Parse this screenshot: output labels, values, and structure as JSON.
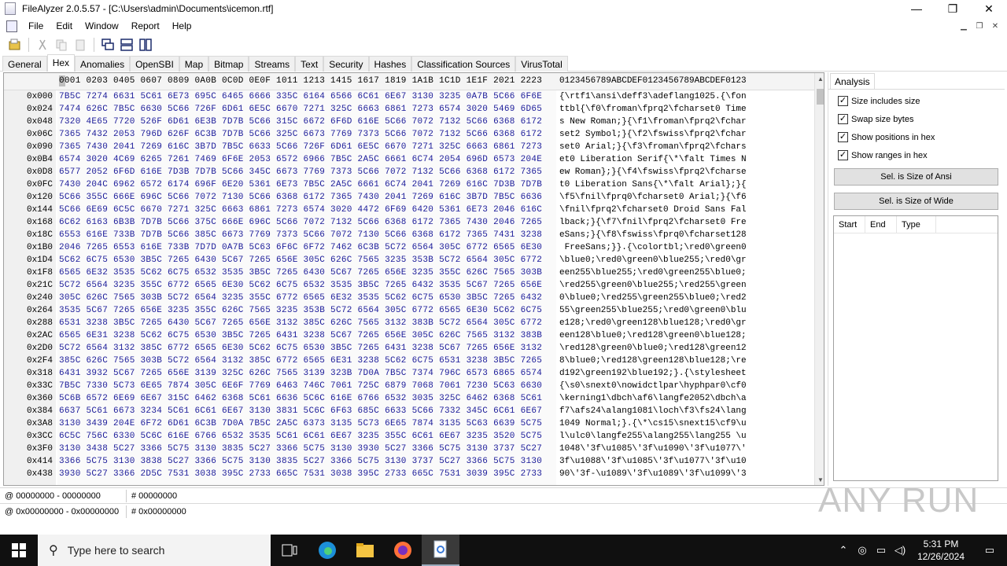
{
  "window": {
    "title": "FileAlyzer 2.0.5.57 - [C:\\Users\\admin\\Documents\\icemon.rtf]",
    "minimize": "—",
    "maximize": "❐",
    "close": "✕"
  },
  "menu": [
    "File",
    "Edit",
    "Window",
    "Report",
    "Help"
  ],
  "tabs": [
    "General",
    "Hex",
    "Anomalies",
    "OpenSBI",
    "Map",
    "Bitmap",
    "Streams",
    "Text",
    "Security",
    "Hashes",
    "Classification Sources",
    "VirusTotal"
  ],
  "active_tab": "Hex",
  "hex": {
    "column_header": "0001 0203 0405 0607 0809 0A0B 0C0D 0E0F 1011 1213 1415 1617 1819 1A1B 1C1D 1E1F 2021 2223",
    "ascii_header": "0123456789ABCDEF0123456789ABCDEF0123",
    "rows": [
      {
        "off": "0x000",
        "hex": "7B5C 7274 6631 5C61 6E73 695C 6465 6666 335C 6164 6566 6C61 6E67 3130 3235 0A7B 5C66 6F6E",
        "asc": "{\\rtf1\\ansi\\deff3\\adeflang1025.{\\fon"
      },
      {
        "off": "0x024",
        "hex": "7474 626C 7B5C 6630 5C66 726F 6D61 6E5C 6670 7271 325C 6663 6861 7273 6574 3020 5469 6D65",
        "asc": "ttbl{\\f0\\froman\\fprq2\\fcharset0 Time"
      },
      {
        "off": "0x048",
        "hex": "7320 4E65 7720 526F 6D61 6E3B 7D7B 5C66 315C 6672 6F6D 616E 5C66 7072 7132 5C66 6368 6172",
        "asc": "s New Roman;}{\\f1\\froman\\fprq2\\fchar"
      },
      {
        "off": "0x06C",
        "hex": "7365 7432 2053 796D 626F 6C3B 7D7B 5C66 325C 6673 7769 7373 5C66 7072 7132 5C66 6368 6172",
        "asc": "set2 Symbol;}{\\f2\\fswiss\\fprq2\\fchar"
      },
      {
        "off": "0x090",
        "hex": "7365 7430 2041 7269 616C 3B7D 7B5C 6633 5C66 726F 6D61 6E5C 6670 7271 325C 6663 6861 7273",
        "asc": "set0 Arial;}{\\f3\\froman\\fprq2\\fchars"
      },
      {
        "off": "0x0B4",
        "hex": "6574 3020 4C69 6265 7261 7469 6F6E 2053 6572 6966 7B5C 2A5C 6661 6C74 2054 696D 6573 204E",
        "asc": "et0 Liberation Serif{\\*\\falt Times N"
      },
      {
        "off": "0x0D8",
        "hex": "6577 2052 6F6D 616E 7D3B 7D7B 5C66 345C 6673 7769 7373 5C66 7072 7132 5C66 6368 6172 7365",
        "asc": "ew Roman};}{\\f4\\fswiss\\fprq2\\fcharse"
      },
      {
        "off": "0x0FC",
        "hex": "7430 204C 6962 6572 6174 696F 6E20 5361 6E73 7B5C 2A5C 6661 6C74 2041 7269 616C 7D3B 7D7B",
        "asc": "t0 Liberation Sans{\\*\\falt Arial};}{"
      },
      {
        "off": "0x120",
        "hex": "5C66 355C 666E 696C 5C66 7072 7130 5C66 6368 6172 7365 7430 2041 7269 616C 3B7D 7B5C 6636",
        "asc": "\\f5\\fnil\\fprq0\\fcharset0 Arial;}{\\f6"
      },
      {
        "off": "0x144",
        "hex": "5C66 6E69 6C5C 6670 7271 325C 6663 6861 7273 6574 3020 4472 6F69 6420 5361 6E73 2046 616C",
        "asc": "\\fnil\\fprq2\\fcharset0 Droid Sans Fal"
      },
      {
        "off": "0x168",
        "hex": "6C62 6163 6B3B 7D7B 5C66 375C 666E 696C 5C66 7072 7132 5C66 6368 6172 7365 7430 2046 7265",
        "asc": "lback;}{\\f7\\fnil\\fprq2\\fcharset0 Fre"
      },
      {
        "off": "0x18C",
        "hex": "6553 616E 733B 7D7B 5C66 385C 6673 7769 7373 5C66 7072 7130 5C66 6368 6172 7365 7431 3238",
        "asc": "eSans;}{\\f8\\fswiss\\fprq0\\fcharset128"
      },
      {
        "off": "0x1B0",
        "hex": "2046 7265 6553 616E 733B 7D7D 0A7B 5C63 6F6C 6F72 7462 6C3B 5C72 6564 305C 6772 6565 6E30",
        "asc": " FreeSans;}}.{\\colortbl;\\red0\\green0"
      },
      {
        "off": "0x1D4",
        "hex": "5C62 6C75 6530 3B5C 7265 6430 5C67 7265 656E 305C 626C 7565 3235 353B 5C72 6564 305C 6772",
        "asc": "\\blue0;\\red0\\green0\\blue255;\\red0\\gr"
      },
      {
        "off": "0x1F8",
        "hex": "6565 6E32 3535 5C62 6C75 6532 3535 3B5C 7265 6430 5C67 7265 656E 3235 355C 626C 7565 303B",
        "asc": "een255\\blue255;\\red0\\green255\\blue0;"
      },
      {
        "off": "0x21C",
        "hex": "5C72 6564 3235 355C 6772 6565 6E30 5C62 6C75 6532 3535 3B5C 7265 6432 3535 5C67 7265 656E",
        "asc": "\\red255\\green0\\blue255;\\red255\\green"
      },
      {
        "off": "0x240",
        "hex": "305C 626C 7565 303B 5C72 6564 3235 355C 6772 6565 6E32 3535 5C62 6C75 6530 3B5C 7265 6432",
        "asc": "0\\blue0;\\red255\\green255\\blue0;\\red2"
      },
      {
        "off": "0x264",
        "hex": "3535 5C67 7265 656E 3235 355C 626C 7565 3235 353B 5C72 6564 305C 6772 6565 6E30 5C62 6C75",
        "asc": "55\\green255\\blue255;\\red0\\green0\\blu"
      },
      {
        "off": "0x288",
        "hex": "6531 3238 3B5C 7265 6430 5C67 7265 656E 3132 385C 626C 7565 3132 383B 5C72 6564 305C 6772",
        "asc": "e128;\\red0\\green128\\blue128;\\red0\\gr"
      },
      {
        "off": "0x2AC",
        "hex": "6565 6E31 3238 5C62 6C75 6530 3B5C 7265 6431 3238 5C67 7265 656E 305C 626C 7565 3132 383B",
        "asc": "een128\\blue0;\\red128\\green0\\blue128;"
      },
      {
        "off": "0x2D0",
        "hex": "5C72 6564 3132 385C 6772 6565 6E30 5C62 6C75 6530 3B5C 7265 6431 3238 5C67 7265 656E 3132",
        "asc": "\\red128\\green0\\blue0;\\red128\\green12"
      },
      {
        "off": "0x2F4",
        "hex": "385C 626C 7565 303B 5C72 6564 3132 385C 6772 6565 6E31 3238 5C62 6C75 6531 3238 3B5C 7265",
        "asc": "8\\blue0;\\red128\\green128\\blue128;\\re"
      },
      {
        "off": "0x318",
        "hex": "6431 3932 5C67 7265 656E 3139 325C 626C 7565 3139 323B 7D0A 7B5C 7374 796C 6573 6865 6574",
        "asc": "d192\\green192\\blue192;}.{\\stylesheet"
      },
      {
        "off": "0x33C",
        "hex": "7B5C 7330 5C73 6E65 7874 305C 6E6F 7769 6463 746C 7061 725C 6879 7068 7061 7230 5C63 6630",
        "asc": "{\\s0\\snext0\\nowidctlpar\\hyphpar0\\cf0"
      },
      {
        "off": "0x360",
        "hex": "5C6B 6572 6E69 6E67 315C 6462 6368 5C61 6636 5C6C 616E 6766 6532 3035 325C 6462 6368 5C61",
        "asc": "\\kerning1\\dbch\\af6\\langfe2052\\dbch\\a"
      },
      {
        "off": "0x384",
        "hex": "6637 5C61 6673 3234 5C61 6C61 6E67 3130 3831 5C6C 6F63 685C 6633 5C66 7332 345C 6C61 6E67",
        "asc": "f7\\afs24\\alang1081\\loch\\f3\\fs24\\lang"
      },
      {
        "off": "0x3A8",
        "hex": "3130 3439 204E 6F72 6D61 6C3B 7D0A 7B5C 2A5C 6373 3135 5C73 6E65 7874 3135 5C63 6639 5C75",
        "asc": "1049 Normal;}.{\\*\\cs15\\snext15\\cf9\\u"
      },
      {
        "off": "0x3CC",
        "hex": "6C5C 756C 6330 5C6C 616E 6766 6532 3535 5C61 6C61 6E67 3235 355C 6C61 6E67 3235 3520 5C75",
        "asc": "l\\ulc0\\langfe255\\alang255\\lang255 \\u"
      },
      {
        "off": "0x3F0",
        "hex": "3130 3438 5C27 3366 5C75 3130 3835 5C27 3366 5C75 3130 3930 5C27 3366 5C75 3130 3737 5C27",
        "asc": "1048\\'3f\\u1085\\'3f\\u1090\\'3f\\u1077\\'"
      },
      {
        "off": "0x414",
        "hex": "3366 5C75 3130 3838 5C27 3366 5C75 3130 3835 5C27 3366 5C75 3130 3737 5C27 3366 5C75 3130",
        "asc": "3f\\u1088\\'3f\\u1085\\'3f\\u1077\\'3f\\u10"
      },
      {
        "off": "0x438",
        "hex": "3930 5C27 3366 2D5C 7531 3038 395C 2733 665C 7531 3038 395C 2733 665C 7531 3039 395C 2733",
        "asc": "90\\'3f-\\u1089\\'3f\\u1089\\'3f\\u1099\\'3"
      }
    ]
  },
  "analysis": {
    "tab_label": "Analysis",
    "checkboxes": [
      {
        "label": "Size includes size",
        "checked": true
      },
      {
        "label": "Swap size bytes",
        "checked": true
      },
      {
        "label": "Show positions in hex",
        "checked": true
      },
      {
        "label": "Show ranges in hex",
        "checked": true
      }
    ],
    "btn_ansi": "Sel. is Size of Ansi",
    "btn_wide": "Sel. is Size of Wide",
    "list_headers": [
      "Start",
      "End",
      "Type"
    ]
  },
  "status": {
    "row1_range": "@ 00000000 - 00000000",
    "row1_count": "# 00000000",
    "row2_range": "@ 0x00000000 - 0x00000000",
    "row2_count": "# 0x00000000"
  },
  "watermark": "ANY RUN",
  "taskbar": {
    "search_placeholder": "Type here to search",
    "time": "5:31 PM",
    "date": "12/26/2024"
  }
}
